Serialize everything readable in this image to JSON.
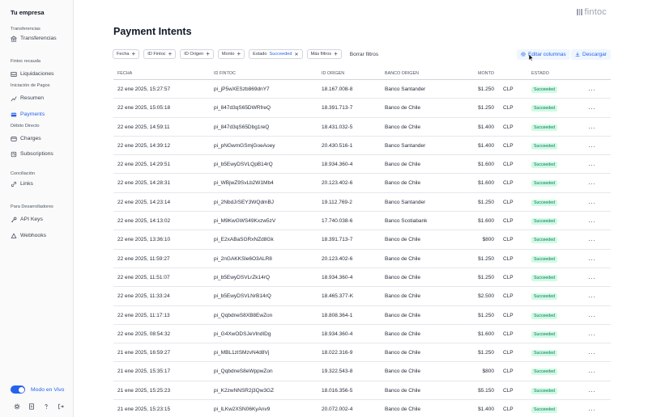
{
  "company": "Tu empresa",
  "sidebar": {
    "sections": [
      {
        "label": "Transferencias"
      },
      {
        "label": "Fintoc recauda"
      },
      {
        "label": "Iniciación de Pagos"
      },
      {
        "label": "Débito Directo"
      },
      {
        "label": "Conciliación"
      },
      {
        "label": "Para Desarrolladores"
      }
    ],
    "items": [
      {
        "label": "Transferencias",
        "icon": "bank-icon"
      },
      {
        "label": "Liquidaciones",
        "icon": "inbox-icon"
      },
      {
        "label": "Resumen",
        "icon": "chart-icon"
      },
      {
        "label": "Payments",
        "icon": "card-icon",
        "active": true
      },
      {
        "label": "Charges",
        "icon": "wallet-icon"
      },
      {
        "label": "Subscriptions",
        "icon": "refresh-icon"
      },
      {
        "label": "Links",
        "icon": "link-icon"
      },
      {
        "label": "API Keys",
        "icon": "key-icon"
      },
      {
        "label": "Webhooks",
        "icon": "webhook-icon"
      }
    ],
    "live_mode_label": "Modo en Vivo",
    "live_mode_on": true
  },
  "brand": {
    "logo_text": "fintoc"
  },
  "page_title": "Payment Intents",
  "filters": {
    "chips": [
      "Fecha",
      "ID Fintoc",
      "ID Origen",
      "Monto"
    ],
    "estado_label": "Estado",
    "estado_value": "Succeeded",
    "more_filters": "Más filtros",
    "clear": "Borrar filtros"
  },
  "actions": {
    "edit_columns": "Editar columnas",
    "download": "Descargar"
  },
  "table": {
    "headers": {
      "fecha": "FECHA",
      "id_fintoc": "ID FINTOC",
      "id_origen": "ID ORIGEN",
      "banco": "BANCO ORIGEN",
      "monto": "MONTO",
      "estado": "ESTADO"
    },
    "rows": [
      {
        "fecha": "22 ene 2025, 15:27:57",
        "id": "pi_jP5wXESzb869dnY7",
        "origen": "18.167.008-8",
        "banco": "Banco Santander",
        "monto": "$1.250",
        "currency": "CLP",
        "estado": "Succeeded"
      },
      {
        "fecha": "22 ene 2025, 15:05:18",
        "id": "pi_847d3qS65DWRfreQ",
        "origen": "18.391.713-7",
        "banco": "Banco de Chile",
        "monto": "$1.250",
        "currency": "CLP",
        "estado": "Succeeded"
      },
      {
        "fecha": "22 ene 2025, 14:59:11",
        "id": "pi_847d3qS65Dbg1reQ",
        "origen": "18.431.032-5",
        "banco": "Banco de Chile",
        "monto": "$1.400",
        "currency": "CLP",
        "estado": "Succeeded"
      },
      {
        "fecha": "22 ene 2025, 14:39:12",
        "id": "pi_pNGwmGSmjGoeAoey",
        "origen": "20.430.516-1",
        "banco": "Banco Santander",
        "monto": "$1.400",
        "currency": "CLP",
        "estado": "Succeeded"
      },
      {
        "fecha": "22 ene 2025, 14:29:51",
        "id": "pi_b5EwyDSVLQpB14rQ",
        "origen": "18.934.360-4",
        "banco": "Banco de Chile",
        "monto": "$1.600",
        "currency": "CLP",
        "estado": "Succeeded"
      },
      {
        "fecha": "22 ene 2025, 14:28:31",
        "id": "pi_WBjwZ9SvLb2W1Mb4",
        "origen": "20.123.402-6",
        "banco": "Banco de Chile",
        "monto": "$1.600",
        "currency": "CLP",
        "estado": "Succeeded"
      },
      {
        "fecha": "22 ene 2025, 14:23:14",
        "id": "pi_2NbdJrSEY3WQdmBJ",
        "origen": "19.112.769-2",
        "banco": "Banco Santander",
        "monto": "$1.250",
        "currency": "CLP",
        "estado": "Succeeded"
      },
      {
        "fecha": "22 ene 2025, 14:13:02",
        "id": "pi_M9KwGWS49Kxzw5zV",
        "origen": "17.740.038-6",
        "banco": "Banco Scotiabank",
        "monto": "$1.600",
        "currency": "CLP",
        "estado": "Succeeded"
      },
      {
        "fecha": "22 ene 2025, 13:36:10",
        "id": "pi_E2xABaSGRxNZd8Gk",
        "origen": "18.391.713-7",
        "banco": "Banco de Chile",
        "monto": "$800",
        "currency": "CLP",
        "estado": "Succeeded"
      },
      {
        "fecha": "22 ene 2025, 11:59:27",
        "id": "pi_2nGAKKSle6O3ALR8",
        "origen": "20.123.402-6",
        "banco": "Banco de Chile",
        "monto": "$1.250",
        "currency": "CLP",
        "estado": "Succeeded"
      },
      {
        "fecha": "22 ene 2025, 11:51:07",
        "id": "pi_b5EwyDSVLrZk14rQ",
        "origen": "18.934.360-4",
        "banco": "Banco de Chile",
        "monto": "$1.250",
        "currency": "CLP",
        "estado": "Succeeded"
      },
      {
        "fecha": "22 ene 2025, 11:33:24",
        "id": "pi_b5EwyDSVLNrB14rQ",
        "origen": "18.465.377-K",
        "banco": "Banco de Chile",
        "monto": "$2.500",
        "currency": "CLP",
        "estado": "Succeeded"
      },
      {
        "fecha": "22 ene 2025, 11:17:13",
        "id": "pi_QqbdneS8XB8EwZon",
        "origen": "18.808.364-1",
        "banco": "Banco de Chile",
        "monto": "$1.250",
        "currency": "CLP",
        "estado": "Succeeded"
      },
      {
        "fecha": "22 ene 2025, 08:54:32",
        "id": "pi_G4XwODSJeVlndIDg",
        "origen": "18.934.360-4",
        "banco": "Banco de Chile",
        "monto": "$1.600",
        "currency": "CLP",
        "estado": "Succeeded"
      },
      {
        "fecha": "21 ene 2025, 16:59:27",
        "id": "pi_MBL1zISMzvN4d8Vj",
        "origen": "18.022.316-9",
        "banco": "Banco de Chile",
        "monto": "$1.250",
        "currency": "CLP",
        "estado": "Succeeded"
      },
      {
        "fecha": "21 ene 2025, 15:35:17",
        "id": "pi_QqbdneS8eWppwZon",
        "origen": "19.322.543-8",
        "banco": "Banco de Chile",
        "monto": "$800",
        "currency": "CLP",
        "estado": "Succeeded"
      },
      {
        "fecha": "21 ene 2025, 15:25:23",
        "id": "pi_K2zwNNSR2j3Qw3GZ",
        "origen": "18.016.356-5",
        "banco": "Banco de Chile",
        "monto": "$5.150",
        "currency": "CLP",
        "estado": "Succeeded"
      },
      {
        "fecha": "21 ene 2025, 15:23:15",
        "id": "pi_lLKw2XSN06KyAnv9",
        "origen": "20.072.002-4",
        "banco": "Banco de Chile",
        "monto": "$1.400",
        "currency": "CLP",
        "estado": "Succeeded"
      }
    ],
    "row_menu": "···"
  },
  "colors": {
    "accent": "#2563eb",
    "success_bg": "#d1fae5",
    "success_text": "#047857"
  }
}
